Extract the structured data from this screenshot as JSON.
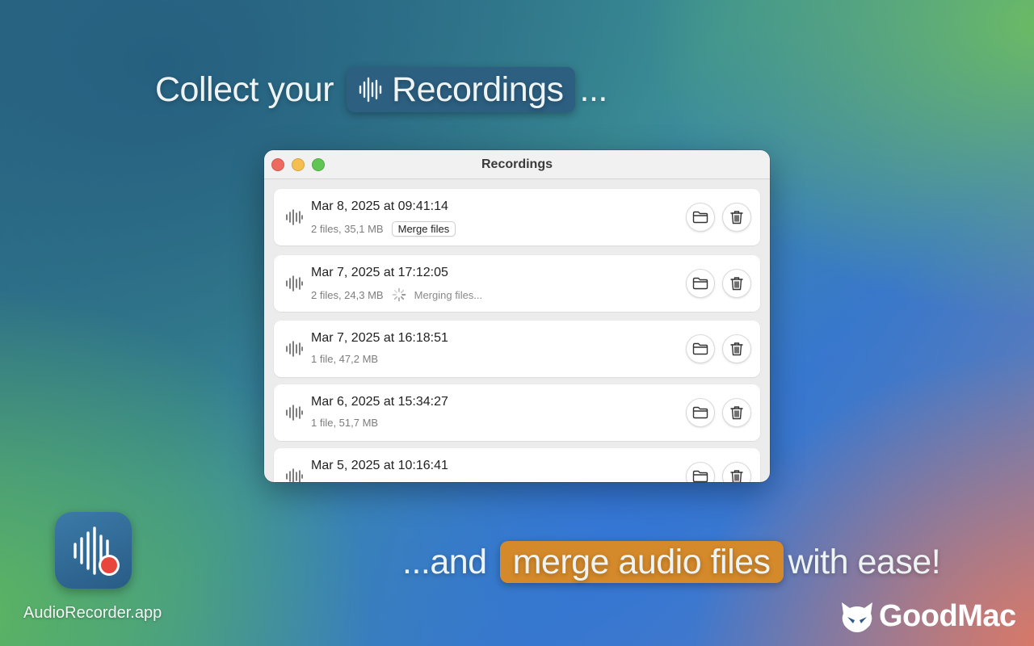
{
  "headline": {
    "prefix": "Collect your",
    "pill_label": "Recordings",
    "suffix": "...",
    "bottom_prefix": "...and",
    "bottom_pill": "merge audio files",
    "bottom_suffix": "with ease!"
  },
  "window": {
    "title": "Recordings",
    "recordings": [
      {
        "date": "Mar 8, 2025 at 09:41:14",
        "meta": "2 files, 35,1 MB",
        "action": "Merge files"
      },
      {
        "date": "Mar 7, 2025 at 17:12:05",
        "meta": "2 files, 24,3 MB",
        "status": "Merging files..."
      },
      {
        "date": "Mar 7, 2025 at 16:18:51",
        "meta": "1 file, 47,2 MB"
      },
      {
        "date": "Mar 6, 2025 at 15:34:27",
        "meta": "1 file, 51,7 MB"
      },
      {
        "date": "Mar 5, 2025 at 10:16:41",
        "meta": ""
      }
    ]
  },
  "app": {
    "label": "AudioRecorder.app"
  },
  "brand": {
    "name": "GoodMac"
  },
  "colors": {
    "pill_blue": "#2c5f80",
    "pill_orange": "#d4892a",
    "record_red": "#e8463c"
  },
  "icons": {
    "waveform": "waveform-icon",
    "folder": "folder-icon",
    "trash": "trash-icon",
    "spinner": "spinner-icon",
    "logo": "goodmac-logo-icon"
  }
}
